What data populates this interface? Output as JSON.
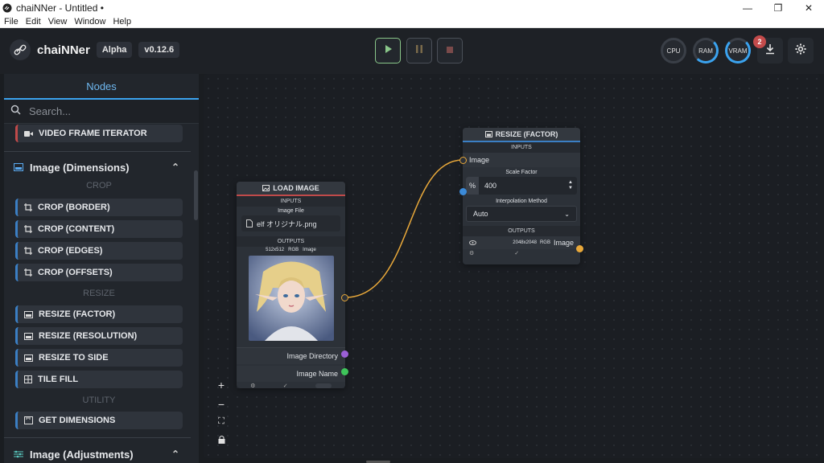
{
  "window": {
    "title": "chaiNNer - Untitled •"
  },
  "menu": [
    "File",
    "Edit",
    "View",
    "Window",
    "Help"
  ],
  "header": {
    "app_name": "chaiNNer",
    "channel": "Alpha",
    "version": "v0.12.6",
    "gauges": {
      "cpu": "CPU",
      "ram": "RAM",
      "vram": "VRAM"
    },
    "notification_count": "2"
  },
  "sidebar": {
    "title": "Nodes",
    "search_placeholder": "Search...",
    "top_item": "VIDEO FRAME ITERATOR",
    "category_dimensions": "Image (Dimensions)",
    "section_crop": "CROP",
    "crop_items": [
      "CROP (BORDER)",
      "CROP (CONTENT)",
      "CROP (EDGES)",
      "CROP (OFFSETS)"
    ],
    "section_resize": "RESIZE",
    "resize_items": [
      "RESIZE (FACTOR)",
      "RESIZE (RESOLUTION)",
      "RESIZE TO SIDE",
      "TILE FILL"
    ],
    "section_utility": "UTILITY",
    "utility_items": [
      "GET DIMENSIONS"
    ],
    "category_adjustments": "Image (Adjustments)"
  },
  "load_image_node": {
    "title": "LOAD IMAGE",
    "inputs_label": "INPUTS",
    "image_file_label": "Image File",
    "file_name": "elf オリジナル.png",
    "outputs_label": "OUTPUTS",
    "image_info": "512x512",
    "image_mode": "RGB",
    "image_output_label": "Image",
    "dir_label": "Image Directory",
    "name_label": "Image Name"
  },
  "resize_node": {
    "title": "RESIZE (FACTOR)",
    "inputs_label": "INPUTS",
    "image_input_label": "Image",
    "scale_label": "Scale Factor",
    "scale_unit": "%",
    "scale_value": "400",
    "interp_label": "Interpolation Method",
    "interp_value": "Auto",
    "outputs_label": "OUTPUTS",
    "out_size": "2048x2048",
    "out_mode": "RGB",
    "out_label": "Image"
  },
  "colors": {
    "accent": "#3ba3ef",
    "image_port": "#e8a83a",
    "dir_port": "#9b5fd6",
    "name_port": "#3ec45a",
    "number_port": "#3b8ad8"
  }
}
